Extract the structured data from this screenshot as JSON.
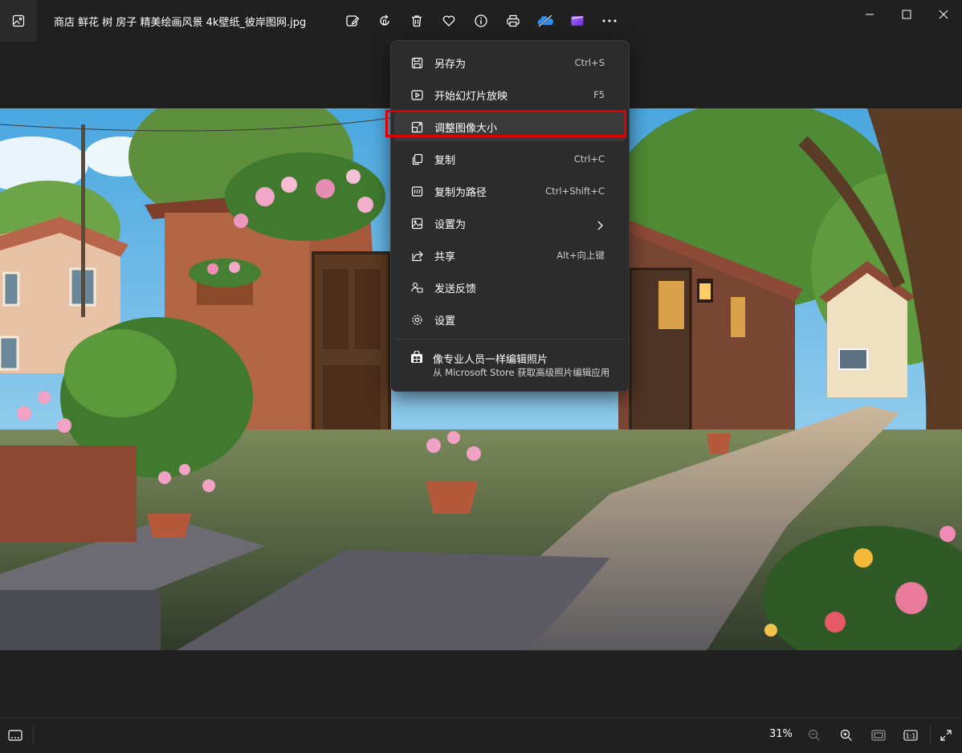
{
  "window": {
    "title": "商店 鲜花 树 房子 精美绘画风景 4k壁纸_彼岸图网.jpg"
  },
  "toolbar": [
    {
      "icon": "edit-image-icon"
    },
    {
      "icon": "rotate-icon"
    },
    {
      "icon": "delete-icon"
    },
    {
      "icon": "favorite-heart-icon"
    },
    {
      "icon": "info-icon"
    },
    {
      "icon": "print-icon"
    },
    {
      "icon": "onedrive-cloud-icon"
    },
    {
      "icon": "clipchamp-icon"
    },
    {
      "icon": "more-options-icon"
    }
  ],
  "context_menu": {
    "items": [
      {
        "label": "另存为",
        "shortcut": "Ctrl+S",
        "icon": "save-icon"
      },
      {
        "label": "开始幻灯片放映",
        "shortcut": "F5",
        "icon": "slideshow-icon"
      },
      {
        "label": "调整图像大小",
        "shortcut": "",
        "icon": "resize-image-icon"
      },
      {
        "label": "复制",
        "shortcut": "Ctrl+C",
        "icon": "copy-icon"
      },
      {
        "label": "复制为路径",
        "shortcut": "Ctrl+Shift+C",
        "icon": "copy-path-icon"
      },
      {
        "label": "设置为",
        "shortcut": "",
        "icon": "set-as-icon"
      },
      {
        "label": "共享",
        "shortcut": "Alt+向上键",
        "icon": "share-icon"
      },
      {
        "label": "发送反馈",
        "shortcut": "",
        "icon": "feedback-icon"
      },
      {
        "label": "设置",
        "shortcut": "",
        "icon": "settings-gear-icon"
      }
    ],
    "promo": {
      "title": "像专业人员一样编辑照片",
      "subtitle": "从 Microsoft Store 获取高级照片编辑应用",
      "icon": "store-icon"
    }
  },
  "status": {
    "zoom": "31%"
  },
  "colors": {
    "background": "#202020",
    "menu_bg": "#2c2c2c",
    "highlight_border": "#e00000"
  }
}
